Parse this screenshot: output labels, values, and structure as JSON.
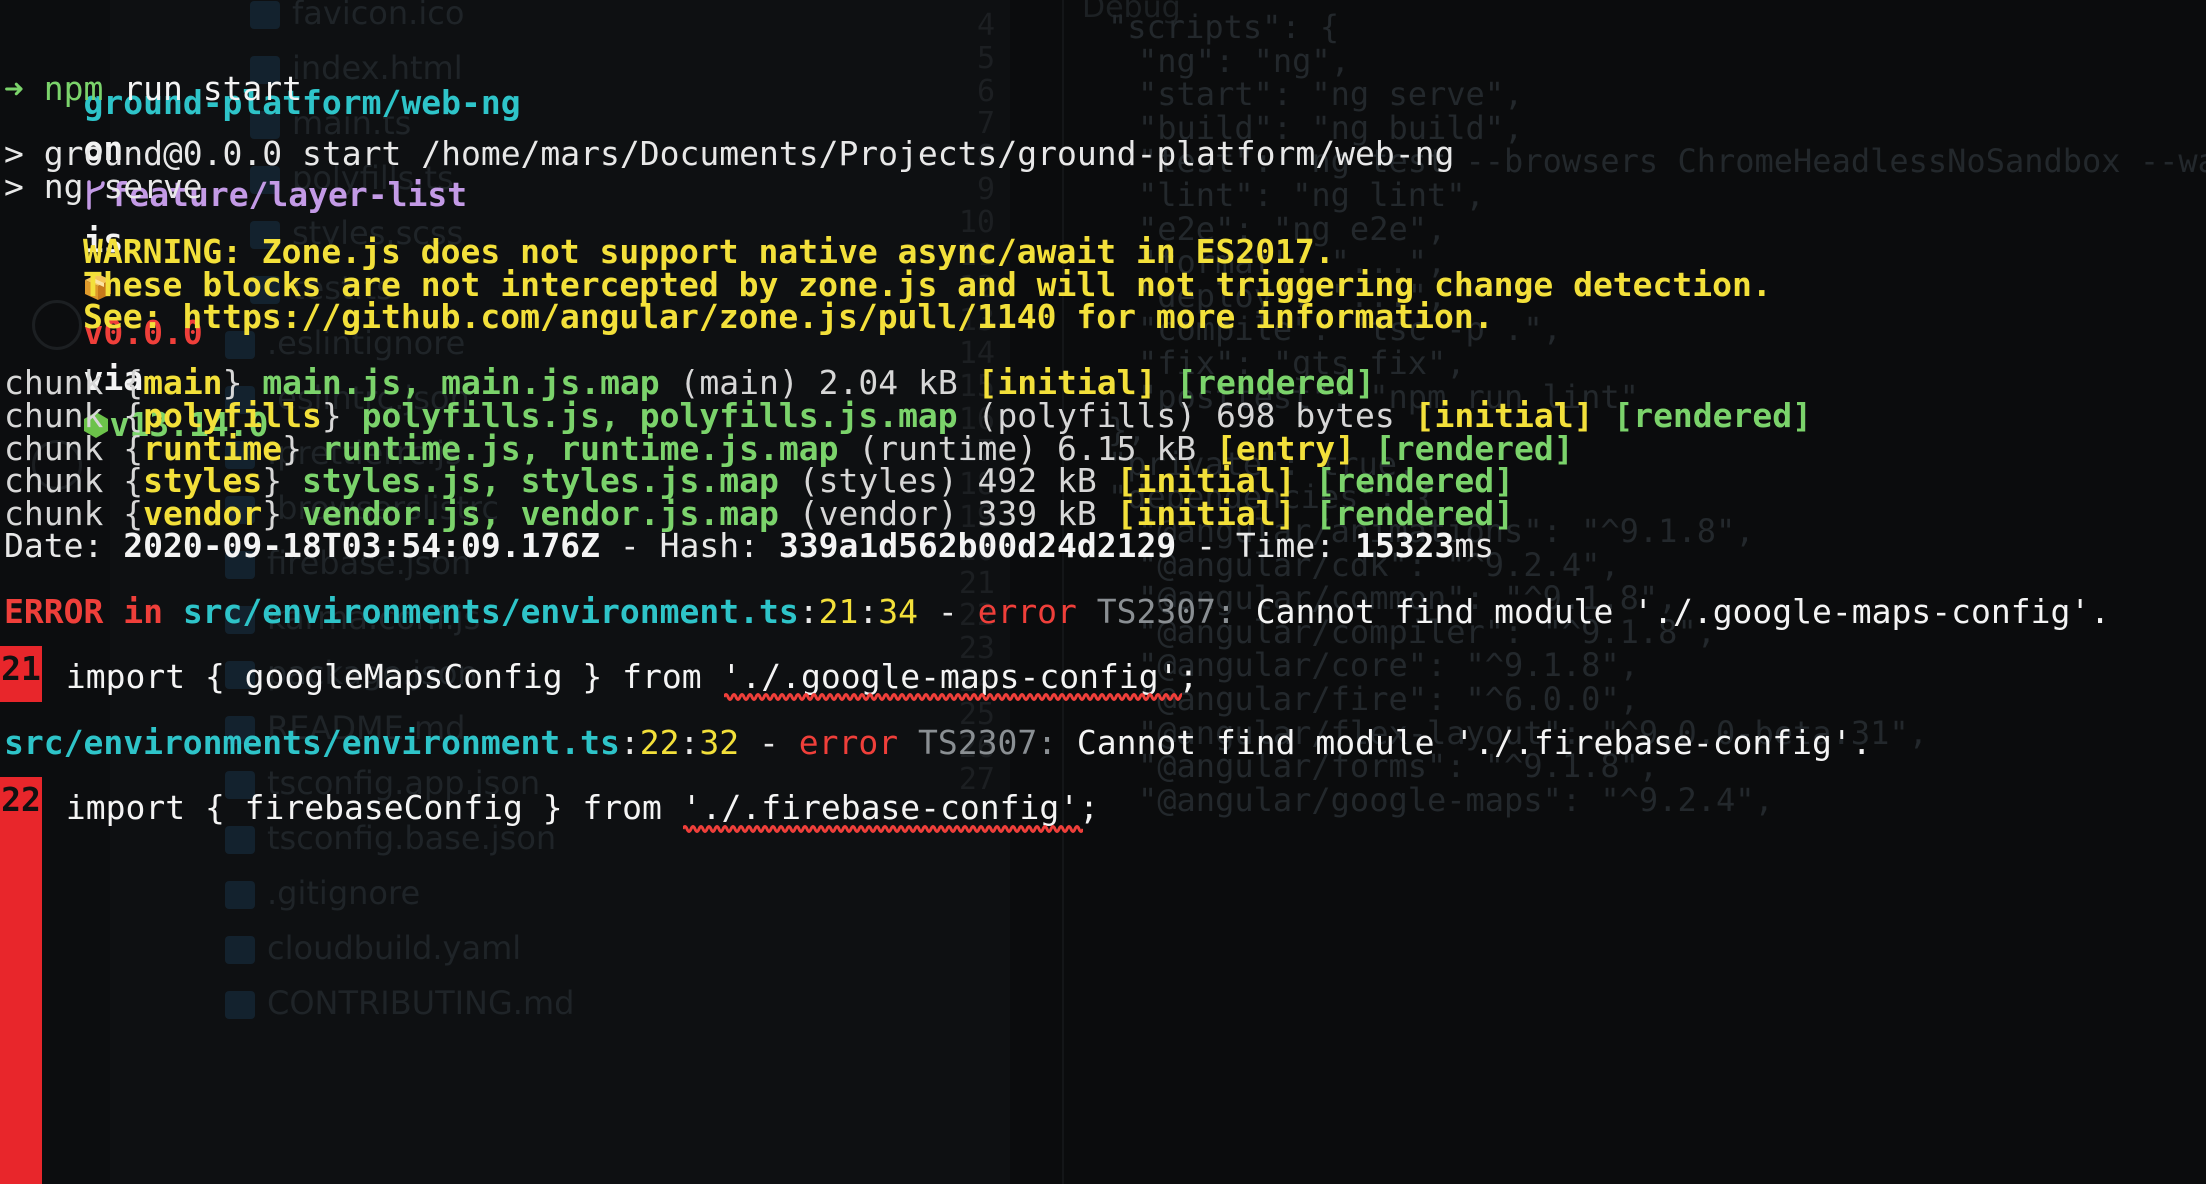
{
  "background_editor": {
    "files": [
      "favicon.ico",
      "index.html",
      "main.ts",
      "polyfills.ts",
      "styles.scss",
      "test.ts",
      ".eslintignore",
      ".eslintrc.json",
      ".prettierrc.js",
      ".browserslistrc",
      "firebase.json",
      "karma.conf.js",
      "package.json",
      "README.md",
      "tsconfig.app.json",
      "tsconfig.base.json",
      ".gitignore",
      "cloudbuild.yaml",
      "CONTRIBUTING.md"
    ],
    "tab_label": "Debug",
    "gutter_numbers": [
      "4",
      "5",
      "6",
      "7",
      "8",
      "9",
      "10",
      "11",
      "12",
      "13",
      "14",
      "15",
      "16",
      "17",
      "18",
      "19",
      "20",
      "21",
      "22",
      "23",
      "24",
      "25",
      "26",
      "27"
    ],
    "code_lines": [
      "\"scripts\": {",
      "\"ng\": \"ng\",",
      "\"start\": \"ng serve\",",
      "\"build\": \"ng build\",",
      "\"test\": \"ng test --browsers ChromeHeadlessNoSandbox --wa",
      "\"lint\": \"ng lint\",",
      "\"e2e\": \"ng e2e\",",
      "\"format\": \"...\",",
      "\"deploy\": \"...\",",
      "\"compile\": \"tsc -p .\",",
      "\"fix\": \"gts fix\",",
      "\"posttest\": \"npm run lint\"",
      "},",
      "\"private\": true,",
      "\"dependencies\": {",
      "\"@angular/animations\": \"^9.1.8\",",
      "\"@angular/cdk\": \"^9.2.4\",",
      "\"@angular/common\": \"^9.1.8\",",
      "\"@angular/compiler\": \"^9.1.8\",",
      "\"@angular/core\": \"^9.1.8\",",
      "\"@angular/fire\": \"^6.0.0\",",
      "\"@angular/flex-layout\": \"^9.0.0-beta.31\",",
      "\"@angular/forms\": \"^9.1.8\",",
      "\"@angular/google-maps\": \"^9.2.4\","
    ]
  },
  "prompt": {
    "dir": "ground-platform/web-ng",
    "on": "on",
    "branch": "feature/layer-list",
    "is": "is",
    "version": "v0.0.0",
    "via": "via",
    "node_version": "v13.14.0",
    "arrow": "➜",
    "command_prog": "npm",
    "command_args": " run start"
  },
  "npm_output": {
    "script_line": "> ground@0.0.0 start /home/mars/Documents/Projects/ground-platform/web-ng",
    "ng_line": "> ng serve"
  },
  "warning": {
    "line1": "WARNING: Zone.js does not support native async/await in ES2017.",
    "line2": "These blocks are not intercepted by zone.js and will not triggering change detection.",
    "line3": "See: https://github.com/angular/zone.js/pull/1140 for more information."
  },
  "chunks": [
    {
      "prefix": "chunk {",
      "name": "main",
      "files": "main.js, main.js.map",
      "meta": " (main) 2.04 kB ",
      "tags": [
        "[initial]",
        "[rendered]"
      ]
    },
    {
      "prefix": "chunk {",
      "name": "polyfills",
      "files": "polyfills.js, polyfills.js.map",
      "meta": " (polyfills) 698 bytes ",
      "tags": [
        "[initial]",
        "[rendered]"
      ]
    },
    {
      "prefix": "chunk {",
      "name": "runtime",
      "files": "runtime.js, runtime.js.map",
      "meta": " (runtime) 6.15 kB ",
      "tags": [
        "[entry]",
        "[rendered]"
      ]
    },
    {
      "prefix": "chunk {",
      "name": "styles",
      "files": "styles.js, styles.js.map",
      "meta": " (styles) 492 kB ",
      "tags": [
        "[initial]",
        "[rendered]"
      ]
    },
    {
      "prefix": "chunk {",
      "name": "vendor",
      "files": "vendor.js, vendor.js.map",
      "meta": " (vendor) 339 kB ",
      "tags": [
        "[initial]",
        "[rendered]"
      ]
    }
  ],
  "build_info": {
    "date_label": "Date: ",
    "date": "2020-09-18T03:54:09.176Z",
    "hash_label": " - Hash: ",
    "hash": "339a1d562b00d24d2129",
    "time_label": " - Time: ",
    "time": "15323",
    "time_unit": "ms"
  },
  "errors": [
    {
      "lead": "ERROR in ",
      "file": "src/environments/environment.ts",
      "pos_sep": ":",
      "line": "21",
      "col": "34",
      "dash": " - ",
      "kind": "error",
      "code": " TS2307: ",
      "message": "Cannot find module './.google-maps-config'.",
      "gutter": "21",
      "source": " import { googleMapsConfig } from './.google-maps-config';"
    },
    {
      "lead": "",
      "file": "src/environments/environment.ts",
      "pos_sep": ":",
      "line": "22",
      "col": "32",
      "dash": " - ",
      "kind": "error",
      "code": " TS2307: ",
      "message": "Cannot find module './.firebase-config'.",
      "gutter": "22",
      "source": " import { firebaseConfig } from './.firebase-config';"
    }
  ],
  "colors": {
    "cyan": "#2ec4c9",
    "purple": "#c39ae6",
    "red": "#ef3f3a",
    "green": "#7bd36b",
    "yellow": "#f3e03a",
    "error_gutter": "#e8262b"
  }
}
